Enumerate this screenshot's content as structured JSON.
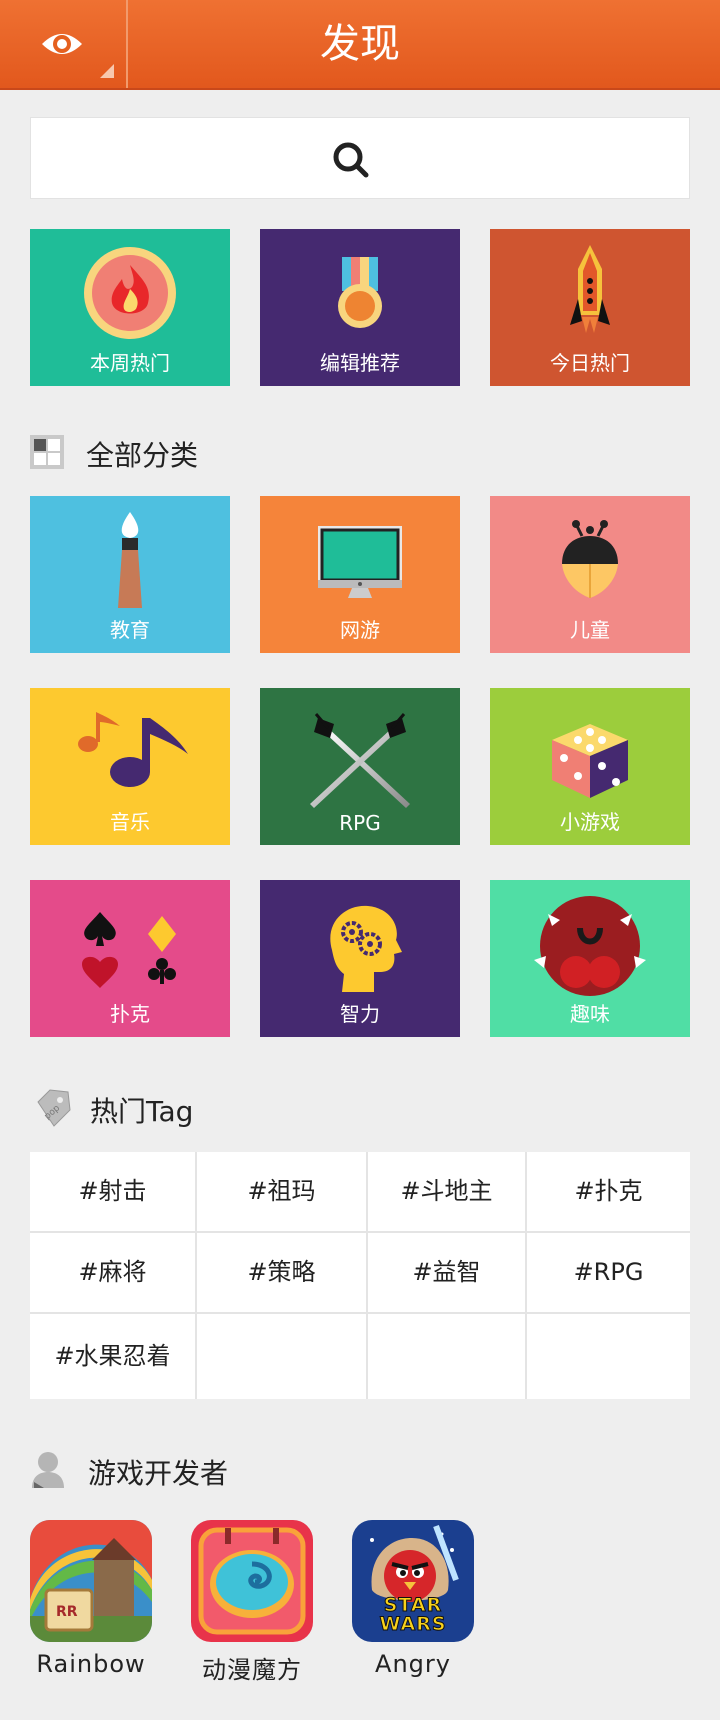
{
  "header": {
    "title": "发现"
  },
  "featured": [
    {
      "label": "本周热门",
      "color": "#1fbd98",
      "icon": "fire-icon"
    },
    {
      "label": "编辑推荐",
      "color": "#452970",
      "icon": "medal-icon"
    },
    {
      "label": "今日热门",
      "color": "#cf5530",
      "icon": "rocket-icon"
    }
  ],
  "categories_title": "全部分类",
  "categories": [
    {
      "label": "教育",
      "color": "#4ec0e0",
      "icon": "paintbrush-icon"
    },
    {
      "label": "网游",
      "color": "#f5843a",
      "icon": "monitor-icon"
    },
    {
      "label": "儿童",
      "color": "#f28a87",
      "icon": "ladybug-icon"
    },
    {
      "label": "音乐",
      "color": "#fdc92f",
      "icon": "music-note-icon"
    },
    {
      "label": "RPG",
      "color": "#2e7443",
      "icon": "crossed-swords-icon"
    },
    {
      "label": "小游戏",
      "color": "#9ccd3c",
      "icon": "dice-icon"
    },
    {
      "label": "扑克",
      "color": "#e44b8a",
      "icon": "card-suits-icon"
    },
    {
      "label": "智力",
      "color": "#452970",
      "icon": "brain-gears-icon"
    },
    {
      "label": "趣味",
      "color": "#50dea5",
      "icon": "monster-icon"
    }
  ],
  "tags_title": "热门Tag",
  "tags": [
    "#射击",
    "#祖玛",
    "#斗地主",
    "#扑克",
    "#麻将",
    "#策略",
    "#益智",
    "#RPG",
    "#水果忍着"
  ],
  "developers_title": "游戏开发者",
  "developers": [
    {
      "name": "Rainbow",
      "icon": "rainbow-castle-app-icon"
    },
    {
      "name": "动漫魔方",
      "icon": "candy-swirl-app-icon"
    },
    {
      "name": "Angry",
      "icon": "angry-birds-star-wars-app-icon",
      "badge": "STAR WARS"
    }
  ]
}
